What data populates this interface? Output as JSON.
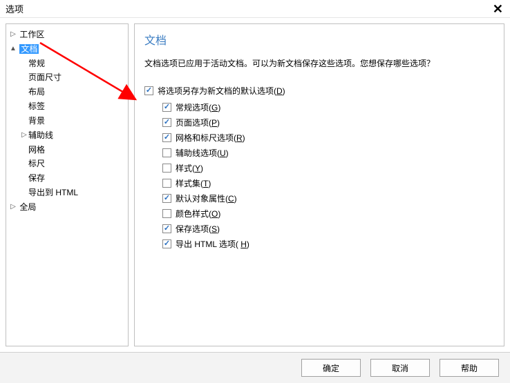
{
  "window": {
    "title": "选项",
    "close_label": "✕"
  },
  "tree": {
    "workspace": "工作区",
    "document": "文档",
    "general": "常规",
    "page_size": "页面尺寸",
    "layout": "布局",
    "tags": "标签",
    "background": "背景",
    "guides": "辅助线",
    "grid": "网格",
    "rulers": "标尺",
    "save": "保存",
    "export_html": "导出到 HTML",
    "global": "全局"
  },
  "content": {
    "title": "文档",
    "description": "文档选项已应用于活动文档。可以为新文档保存这些选项。您想保存哪些选项？",
    "master_label_pre": "将选项另存为新文档的默认选项(",
    "master_accel": "D",
    "master_label_post": ")",
    "opts": {
      "general_pre": "常规选项(",
      "general_accel": "G",
      "general_post": ")",
      "page_pre": "页面选项(",
      "page_accel": "P",
      "page_post": ")",
      "grid_pre": "网格和标尺选项(",
      "grid_accel": "R",
      "grid_post": ")",
      "guide_pre": "辅助线选项(",
      "guide_accel": "U",
      "guide_post": ")",
      "style_pre": "样式(",
      "style_accel": "Y",
      "style_post": ")",
      "styleset_pre": "样式集(",
      "styleset_accel": "T",
      "styleset_post": ")",
      "defobj_pre": "默认对象属性(",
      "defobj_accel": "C",
      "defobj_post": ")",
      "colorstyle_pre": "颜色样式(",
      "colorstyle_accel": "O",
      "colorstyle_post": ")",
      "saveopt_pre": "保存选项(",
      "saveopt_accel": "S",
      "saveopt_post": ")",
      "exporthtml_pre": "导出 HTML 选项( ",
      "exporthtml_accel": "H",
      "exporthtml_post": ")"
    },
    "checked": {
      "master": true,
      "general": true,
      "page": true,
      "grid": true,
      "guide": false,
      "style": false,
      "styleset": false,
      "defobj": true,
      "colorstyle": false,
      "saveopt": true,
      "exporthtml": true
    }
  },
  "buttons": {
    "ok": "确定",
    "cancel": "取消",
    "help": "帮助"
  }
}
